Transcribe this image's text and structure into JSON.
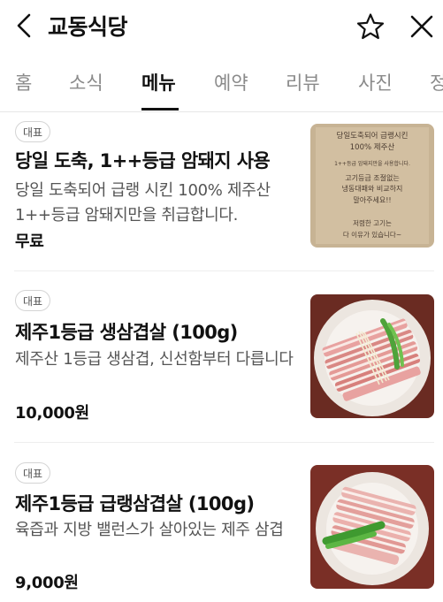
{
  "header": {
    "title": "교동식당",
    "back_icon": "chevron-left-icon",
    "favorite_icon": "star-outline-icon",
    "close_icon": "close-icon"
  },
  "tabs": [
    {
      "label": "홈",
      "active": false
    },
    {
      "label": "소식",
      "active": false
    },
    {
      "label": "메뉴",
      "active": true
    },
    {
      "label": "예약",
      "active": false
    },
    {
      "label": "리뷰",
      "active": false
    },
    {
      "label": "사진",
      "active": false
    },
    {
      "label": "정",
      "active": false
    }
  ],
  "menu_items": [
    {
      "badge": "대표",
      "name": "당일 도축, 1++등급 암돼지 사용",
      "description": "당일 도축되어 급랭 시킨 100% 제주산 1++등급 암돼지만을 취급합니다.",
      "price": "무료",
      "image": "handwritten-note-image",
      "note_lines": [
        "당일도축되어 급랭시킨",
        "100% 제주산",
        "1++등급 암돼지만을 사용합니다.",
        "고기등급 조절없는",
        "냉동대패와 비교하지",
        "말아주세요!!",
        "저렴한 고기는",
        "다 이유가 있습니다~"
      ]
    },
    {
      "badge": "대표",
      "name": "제주1등급 생삼겹살 (100g)",
      "description": "제주산 1등급 생삼겹, 신선함부터 다릅니다",
      "price": "10,000원",
      "image": "pork-belly-plate-image"
    },
    {
      "badge": "대표",
      "name": "제주1등급 급랭삼겹살 (100g)",
      "description": "육즙과 지방 밸런스가 살아있는 제주 삼겹",
      "price": "9,000원",
      "image": "frozen-pork-belly-plate-image"
    }
  ],
  "colors": {
    "text_primary": "#111111",
    "text_secondary": "#555555",
    "tab_inactive": "#8a8a8a",
    "divider": "#eeeeee"
  }
}
